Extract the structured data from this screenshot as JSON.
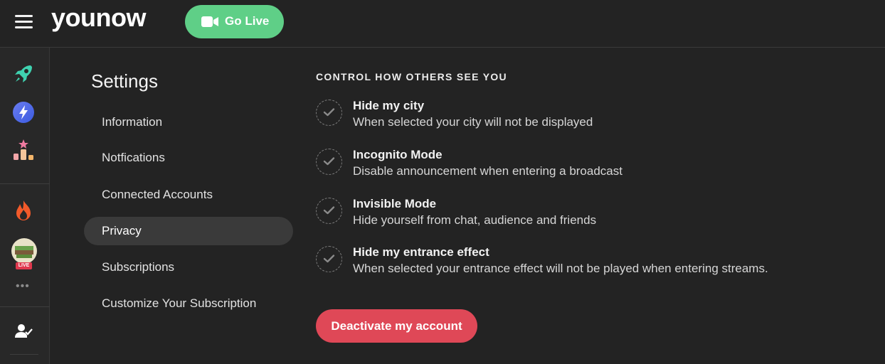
{
  "header": {
    "menu_icon": "hamburger-icon",
    "logo": "younow",
    "go_live_label": "Go Live",
    "go_live_icon": "video-camera-icon",
    "go_live_color": "#5fcf87"
  },
  "rail": {
    "icons": [
      "rocket-icon",
      "lightning-icon",
      "leaderboard-icon",
      "fire-icon",
      "avatar",
      "user-check-icon"
    ],
    "live_badge": "LIVE",
    "more": "•••"
  },
  "settings": {
    "title": "Settings",
    "nav": [
      "Information",
      "Notfications",
      "Connected Accounts",
      "Privacy",
      "Subscriptions",
      "Customize Your Subscription"
    ],
    "active": "Privacy"
  },
  "privacy": {
    "section_title": "CONTROL HOW OTHERS SEE YOU",
    "options": [
      {
        "title": "Hide my city",
        "desc": "When selected your city will not be displayed"
      },
      {
        "title": "Incognito Mode",
        "desc": "Disable announcement when entering a broadcast"
      },
      {
        "title": "Invisible Mode",
        "desc": "Hide yourself from chat, audience and friends"
      },
      {
        "title": "Hide my entrance effect",
        "desc": "When selected your entrance effect will not be played when entering streams."
      }
    ],
    "deactivate_label": "Deactivate my account",
    "deactivate_color": "#df4857"
  }
}
